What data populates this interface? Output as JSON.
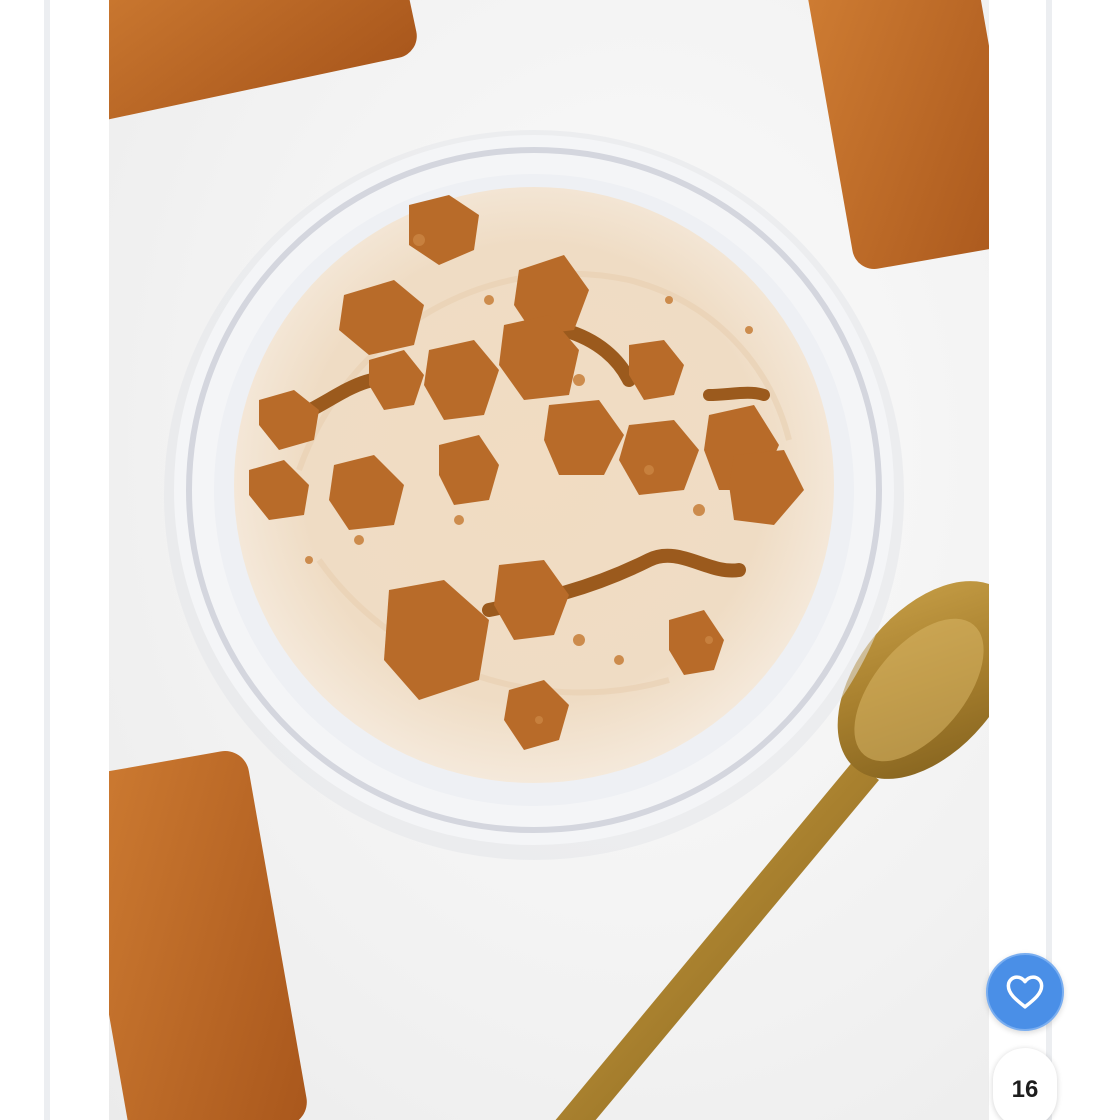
{
  "favorite": {
    "icon": "heart-icon",
    "count": "16",
    "color": "#4a8fe7"
  },
  "photo": {
    "subject": "image"
  }
}
